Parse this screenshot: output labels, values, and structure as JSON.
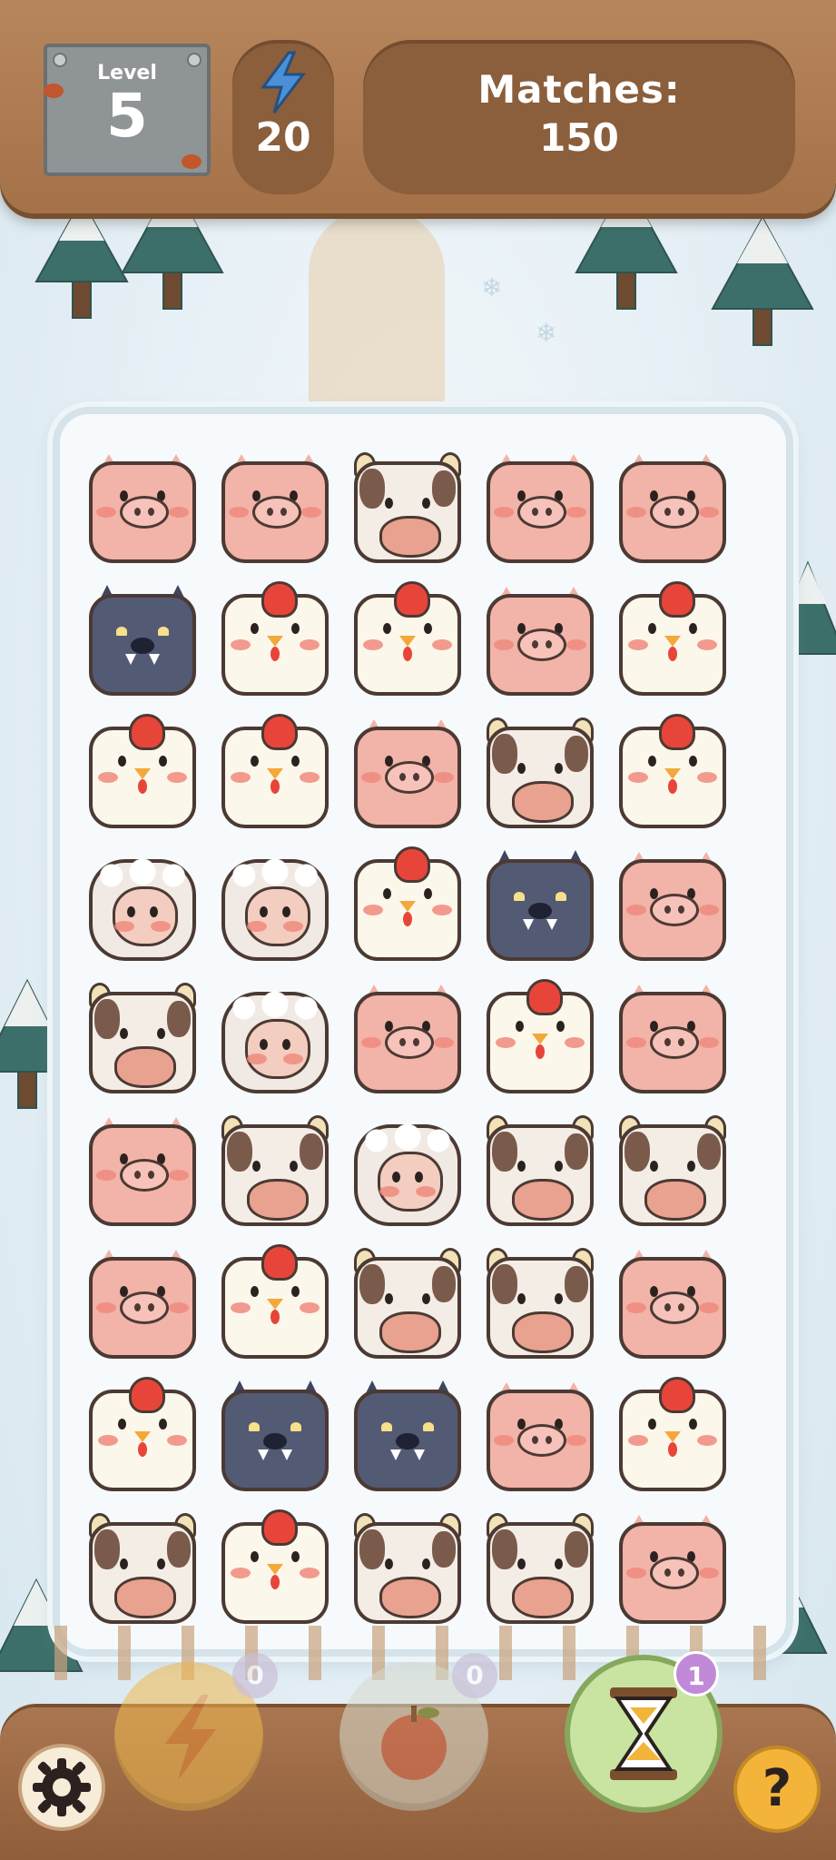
{
  "header": {
    "level_label": "Level",
    "level_value": "5",
    "energy_value": "20",
    "matches_label": "Matches:",
    "matches_value": "150"
  },
  "board": {
    "columns": 5,
    "rows": [
      [
        "pig",
        "pig",
        "cow",
        "pig",
        "pig"
      ],
      [
        "wolf",
        "chicken",
        "chicken",
        "pig",
        "chicken"
      ],
      [
        "chicken",
        "chicken",
        "pig",
        "cow",
        "chicken"
      ],
      [
        "sheep",
        "sheep",
        "chicken",
        "wolf",
        "pig"
      ],
      [
        "cow",
        "sheep",
        "pig",
        "chicken",
        "pig"
      ],
      [
        "pig",
        "cow",
        "sheep",
        "cow",
        "cow"
      ],
      [
        "pig",
        "chicken",
        "cow",
        "cow",
        "pig"
      ],
      [
        "chicken",
        "wolf",
        "wolf",
        "pig",
        "chicken"
      ],
      [
        "cow",
        "chicken",
        "cow",
        "cow",
        "pig"
      ]
    ]
  },
  "boosters": [
    {
      "name": "lightning-booster",
      "icon": "lightning-icon",
      "count": "0",
      "enabled": false
    },
    {
      "name": "apple-booster",
      "icon": "apple-icon",
      "count": "0",
      "enabled": false
    },
    {
      "name": "hourglass-booster",
      "icon": "hourglass-icon",
      "count": "1",
      "enabled": true
    }
  ],
  "buttons": {
    "settings_icon": "gear-icon",
    "help_label": "?"
  },
  "colors": {
    "wood": "#a47148",
    "wood_dark": "#8b5e3c",
    "snow": "#f6fafc",
    "accent_purple": "#c08ad8"
  }
}
